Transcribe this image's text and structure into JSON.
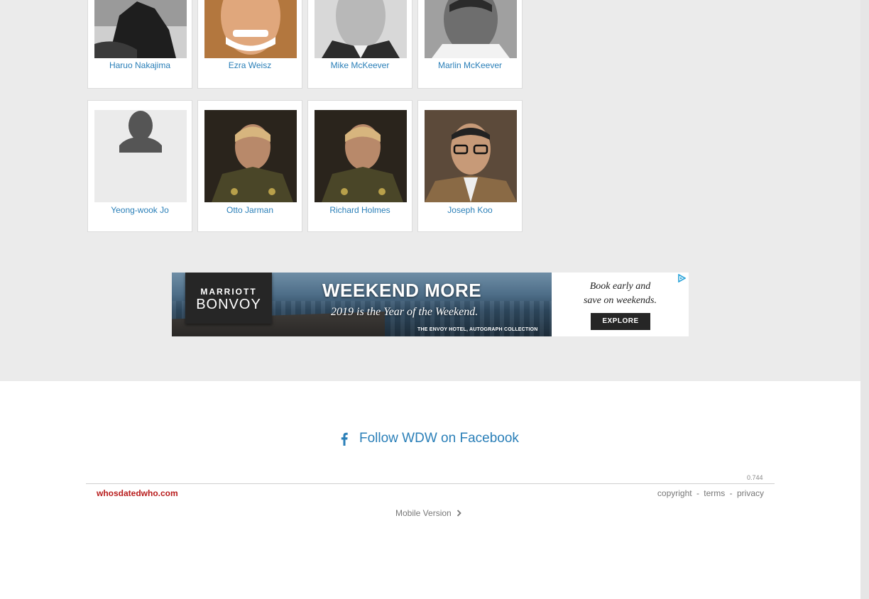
{
  "people_row1": [
    {
      "name": "Haruo Nakajima"
    },
    {
      "name": "Ezra Weisz"
    },
    {
      "name": "Mike McKeever"
    },
    {
      "name": "Marlin McKeever"
    }
  ],
  "people_row2": [
    {
      "name": "Yeong-wook Jo"
    },
    {
      "name": "Otto Jarman"
    },
    {
      "name": "Richard Holmes"
    },
    {
      "name": "Joseph Koo"
    }
  ],
  "ad": {
    "brand_line1": "MARRIOTT",
    "brand_line2": "BONVOY",
    "headline": "WEEKEND MORE",
    "subline": "2019 is the Year of the Weekend.",
    "hotel": "THE ENVOY HOTEL, AUTOGRAPH COLLECTION",
    "tagline_1": "Book early and",
    "tagline_2": "save on weekends.",
    "button": "EXPLORE"
  },
  "footer": {
    "facebook_label": "Follow WDW on Facebook",
    "version": "0.744",
    "site_name": "whosdatedwho.com",
    "links": [
      "copyright",
      "terms",
      "privacy"
    ],
    "separator": "-",
    "mobile_label": "Mobile Version"
  },
  "colors": {
    "link_blue": "#2a7fb8",
    "brand_red": "#b81c1c",
    "page_bg": "#ebebeb"
  }
}
